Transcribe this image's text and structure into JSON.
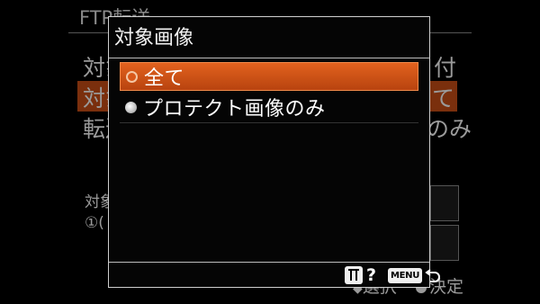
{
  "background": {
    "title": "FTP転送",
    "rows": [
      {
        "label_left": "対象",
        "label_right": "付"
      },
      {
        "label_left": "対象",
        "label_right": "て"
      },
      {
        "label_left": "転送",
        "label_right": "のみ"
      }
    ],
    "small_label_1": "対象",
    "small_label_2": "①(",
    "hint_select": "選択",
    "hint_decide": "決定"
  },
  "dialog": {
    "title": "対象画像",
    "options": [
      {
        "label": "全て",
        "selected": true
      },
      {
        "label": "プロテクト画像のみ",
        "selected": false
      }
    ],
    "footer": {
      "help_mark": "?",
      "menu_key": "MENU"
    }
  },
  "colors": {
    "accent_orange": "#d9581a",
    "selected_bg_dim": "#7a2f0d"
  }
}
